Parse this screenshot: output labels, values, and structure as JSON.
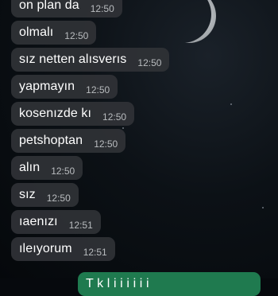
{
  "messages": [
    {
      "text": "on plan da",
      "time": "12:50"
    },
    {
      "text": "olmalı",
      "time": "12:50"
    },
    {
      "text": "sız netten alısverıs",
      "time": "12:50"
    },
    {
      "text": "yapmayın",
      "time": "12:50"
    },
    {
      "text": "kosenızde kı",
      "time": "12:50"
    },
    {
      "text": "petshoptan",
      "time": "12:50"
    },
    {
      "text": "alın",
      "time": "12:50"
    },
    {
      "text": "sız",
      "time": "12:50"
    },
    {
      "text": "ıaenızı",
      "time": "12:51"
    },
    {
      "text": "ıleıyorum",
      "time": "12:51"
    }
  ],
  "outgoing": {
    "text": "T        k       l     i  i i  i i  i"
  },
  "colors": {
    "incoming_bubble": "#303236",
    "outgoing_bubble": "#1f7a4f",
    "time": "#b9bcbf"
  }
}
